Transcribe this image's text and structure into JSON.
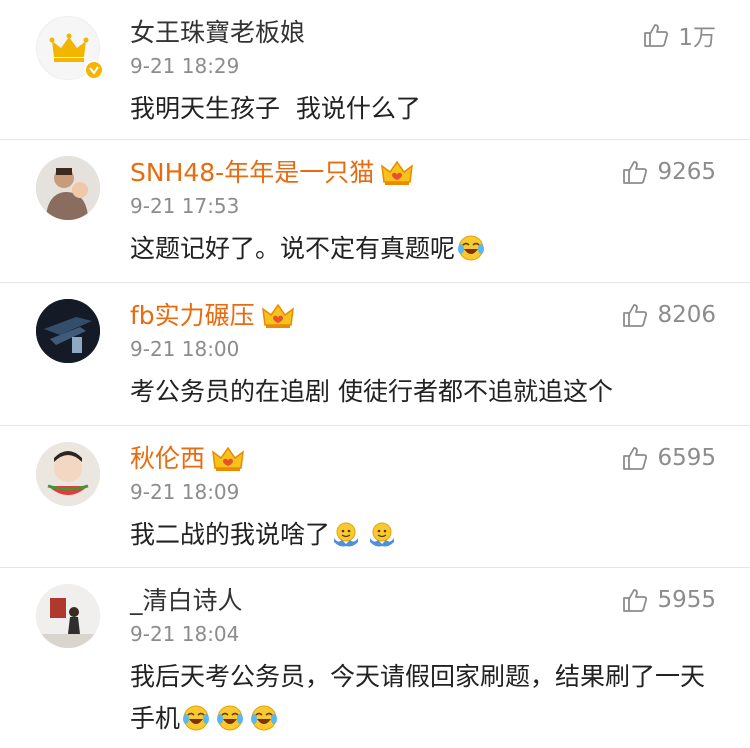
{
  "comments": [
    {
      "username": "女王珠寶老板娘",
      "time": "9-21 18:29",
      "text": "我明天生孩子  我说什么了",
      "likes": "1万",
      "vip": false,
      "verified": true,
      "avatar": "crown-logo-avatar",
      "emojis": []
    },
    {
      "username": "SNH48-年年是一只猫",
      "time": "9-21 17:53",
      "text": "这题记好了。说不定有真题呢",
      "likes": "9265",
      "vip": true,
      "avatar": "person-photo-avatar",
      "emojis": [
        "laugh-cry-emoji"
      ]
    },
    {
      "username": "fb实力碾压",
      "time": "9-21 18:00",
      "text": "考公务员的在追剧 使徒行者都不追就追这个",
      "likes": "8206",
      "vip": true,
      "avatar": "dark-photo-avatar",
      "emojis": []
    },
    {
      "username": "秋伦西",
      "time": "9-21 18:09",
      "text": "我二战的我说啥了",
      "likes": "6595",
      "vip": true,
      "avatar": "child-watermelon-avatar",
      "emojis": [
        "shrug-emoji",
        "shrug-emoji"
      ]
    },
    {
      "username": "_清白诗人",
      "time": "9-21 18:04",
      "text": "我后天考公务员，今天请假回家刷题，结果刷了一天手机",
      "likes": "5955",
      "vip": false,
      "avatar": "room-photo-avatar",
      "emojis": [
        "laugh-cry-emoji",
        "laugh-cry-emoji",
        "laugh-cry-emoji"
      ]
    }
  ],
  "colors": {
    "vip_name": "#e86b0f",
    "normal_name": "#333333",
    "meta": "#8c8c8c",
    "divider": "#e6e6e6",
    "crown_badge": "#f5b400"
  }
}
